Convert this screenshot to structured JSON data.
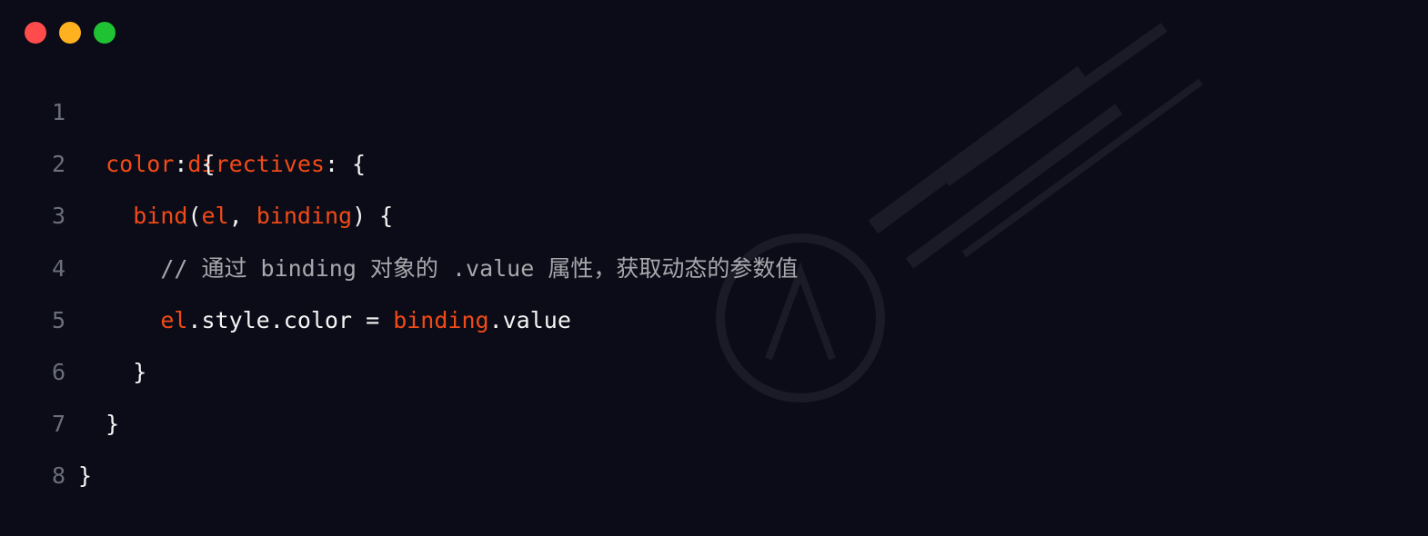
{
  "window": {
    "buttons": {
      "close_color": "#ff4b4b",
      "minimize_color": "#ffb11f",
      "maximize_color": "#1fc233"
    }
  },
  "code": {
    "lines": [
      {
        "number": "1",
        "tokens": [
          {
            "text": "directives",
            "type": "kw"
          },
          {
            "text": ": {",
            "type": "pl"
          }
        ]
      },
      {
        "number": "2",
        "tokens": [
          {
            "text": "  ",
            "type": "pl"
          },
          {
            "text": "color",
            "type": "kw"
          },
          {
            "text": ": {",
            "type": "pl"
          }
        ]
      },
      {
        "number": "3",
        "tokens": [
          {
            "text": "    ",
            "type": "pl"
          },
          {
            "text": "bind",
            "type": "kw"
          },
          {
            "text": "(",
            "type": "pl"
          },
          {
            "text": "el",
            "type": "kw"
          },
          {
            "text": ", ",
            "type": "pl"
          },
          {
            "text": "binding",
            "type": "kw"
          },
          {
            "text": ") {",
            "type": "pl"
          }
        ]
      },
      {
        "number": "4",
        "tokens": [
          {
            "text": "      ",
            "type": "pl"
          },
          {
            "text": "// 通过 binding 对象的 .value 属性，获取动态的参数值",
            "type": "cm"
          }
        ]
      },
      {
        "number": "5",
        "tokens": [
          {
            "text": "      ",
            "type": "pl"
          },
          {
            "text": "el",
            "type": "kw"
          },
          {
            "text": ".style.color = ",
            "type": "pl"
          },
          {
            "text": "binding",
            "type": "kw"
          },
          {
            "text": ".value",
            "type": "pl"
          }
        ]
      },
      {
        "number": "6",
        "tokens": [
          {
            "text": "    }",
            "type": "pl"
          }
        ]
      },
      {
        "number": "7",
        "tokens": [
          {
            "text": "  }",
            "type": "pl"
          }
        ]
      },
      {
        "number": "8",
        "tokens": [
          {
            "text": "}",
            "type": "pl"
          }
        ]
      }
    ]
  }
}
